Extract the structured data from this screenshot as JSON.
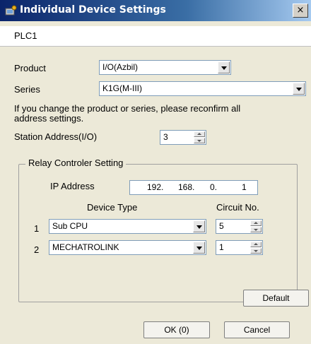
{
  "window": {
    "title": "Individual Device Settings",
    "close_label": "×"
  },
  "header": {
    "text": "PLC1"
  },
  "product": {
    "label": "Product",
    "value": "I/O(Azbil)"
  },
  "series": {
    "label": "Series",
    "value": "K1G(M-III)"
  },
  "note": {
    "line1": "If you change the product or series, please reconfirm all",
    "line2": "address settings."
  },
  "station": {
    "label": "Station Address(I/O)",
    "value": "3"
  },
  "relay": {
    "title": "Relay Controler Setting",
    "ip_label": "IP Address",
    "ip": [
      "192.",
      "168.",
      "0.",
      "1"
    ],
    "col_device_type": "Device Type",
    "col_circuit_no": "Circuit No.",
    "rows": [
      {
        "num": "1",
        "device": "Sub CPU",
        "circuit": "5"
      },
      {
        "num": "2",
        "device": "MECHATROLINK",
        "circuit": "1"
      }
    ]
  },
  "buttons": {
    "default": "Default",
    "ok": "OK (0)",
    "cancel": "Cancel"
  }
}
